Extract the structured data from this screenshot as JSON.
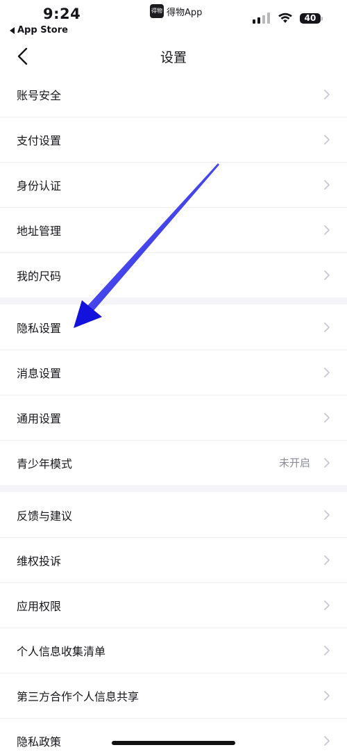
{
  "status_bar": {
    "time": "9:24",
    "back_app_label": "App Store",
    "center_app_name": "得物App",
    "center_app_logo_text": "得物",
    "battery_level": "40",
    "icons": [
      "signal-icon",
      "wifi-icon",
      "battery-icon"
    ]
  },
  "nav": {
    "title": "设置",
    "back_icon": "chevron-left-icon"
  },
  "sections": [
    {
      "items": [
        {
          "label": "账号安全"
        },
        {
          "label": "支付设置"
        },
        {
          "label": "身份认证"
        },
        {
          "label": "地址管理"
        },
        {
          "label": "我的尺码"
        }
      ]
    },
    {
      "items": [
        {
          "label": "隐私设置"
        },
        {
          "label": "消息设置"
        },
        {
          "label": "通用设置"
        },
        {
          "label": "青少年模式",
          "value": "未开启"
        }
      ]
    },
    {
      "items": [
        {
          "label": "反馈与建议"
        },
        {
          "label": "维权投诉"
        },
        {
          "label": "应用权限"
        },
        {
          "label": "个人信息收集清单"
        },
        {
          "label": "第三方合作个人信息共享"
        },
        {
          "label": "隐私政策"
        }
      ]
    }
  ],
  "colors": {
    "text_primary": "#16161a",
    "text_secondary": "#8a8a99",
    "divider": "#efeff3",
    "section_gap": "#f5f5f9",
    "chevron": "#c7c7cf",
    "annotation_arrow": "#1a1ae0"
  }
}
